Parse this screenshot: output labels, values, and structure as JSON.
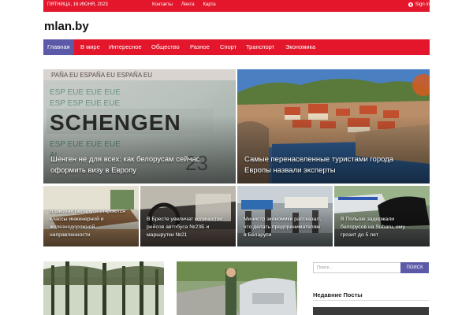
{
  "topbar": {
    "date": "пятница, 16 июня, 2023",
    "links": [
      "Контакты",
      "Лента",
      "Карта"
    ],
    "signin": "Sign in"
  },
  "site": {
    "logo": "mlan.by"
  },
  "nav": {
    "items": [
      "Главная",
      "В мире",
      "Интересное",
      "Общество",
      "Разное",
      "Спорт",
      "Транспорт",
      "Экономика"
    ],
    "active": "Главная",
    "accent": "#e3162b",
    "active_color": "#5c5aa8"
  },
  "featured": {
    "big": [
      {
        "caption": "Шенген не для всех: как белорусам сейчас оформить визу в Европу",
        "image": "schengen-visa-photo",
        "stamp": "SCHENGEN"
      },
      {
        "caption": "Самые перенаселенные туристами города Европы назвали эксперты",
        "image": "dubrovnik-city-photo"
      }
    ],
    "small": [
      {
        "caption": "В школах Беларуси откроются классы инженерной и железнодорожной направленности",
        "image": "classroom-photo"
      },
      {
        "caption": "В Бресте увеличат количество рейсов автобуса №23Б и маршрутки №21",
        "image": "bus-interior-photo"
      },
      {
        "caption": "Министр экономики рассказал, что делать предпринимателям в Беларуси",
        "image": "market-photo"
      },
      {
        "caption": "В Польше задержали белорусов на Subaru, ему грозит до 5 лет",
        "image": "police-car-photo"
      }
    ]
  },
  "sidebar": {
    "search_placeholder": "Поиск...",
    "search_button": "ПОИСК",
    "recent_title": "Недавние Посты"
  },
  "bottom": {
    "images": [
      "forest-photo",
      "police-officer-photo",
      "recent-post-thumb"
    ]
  }
}
